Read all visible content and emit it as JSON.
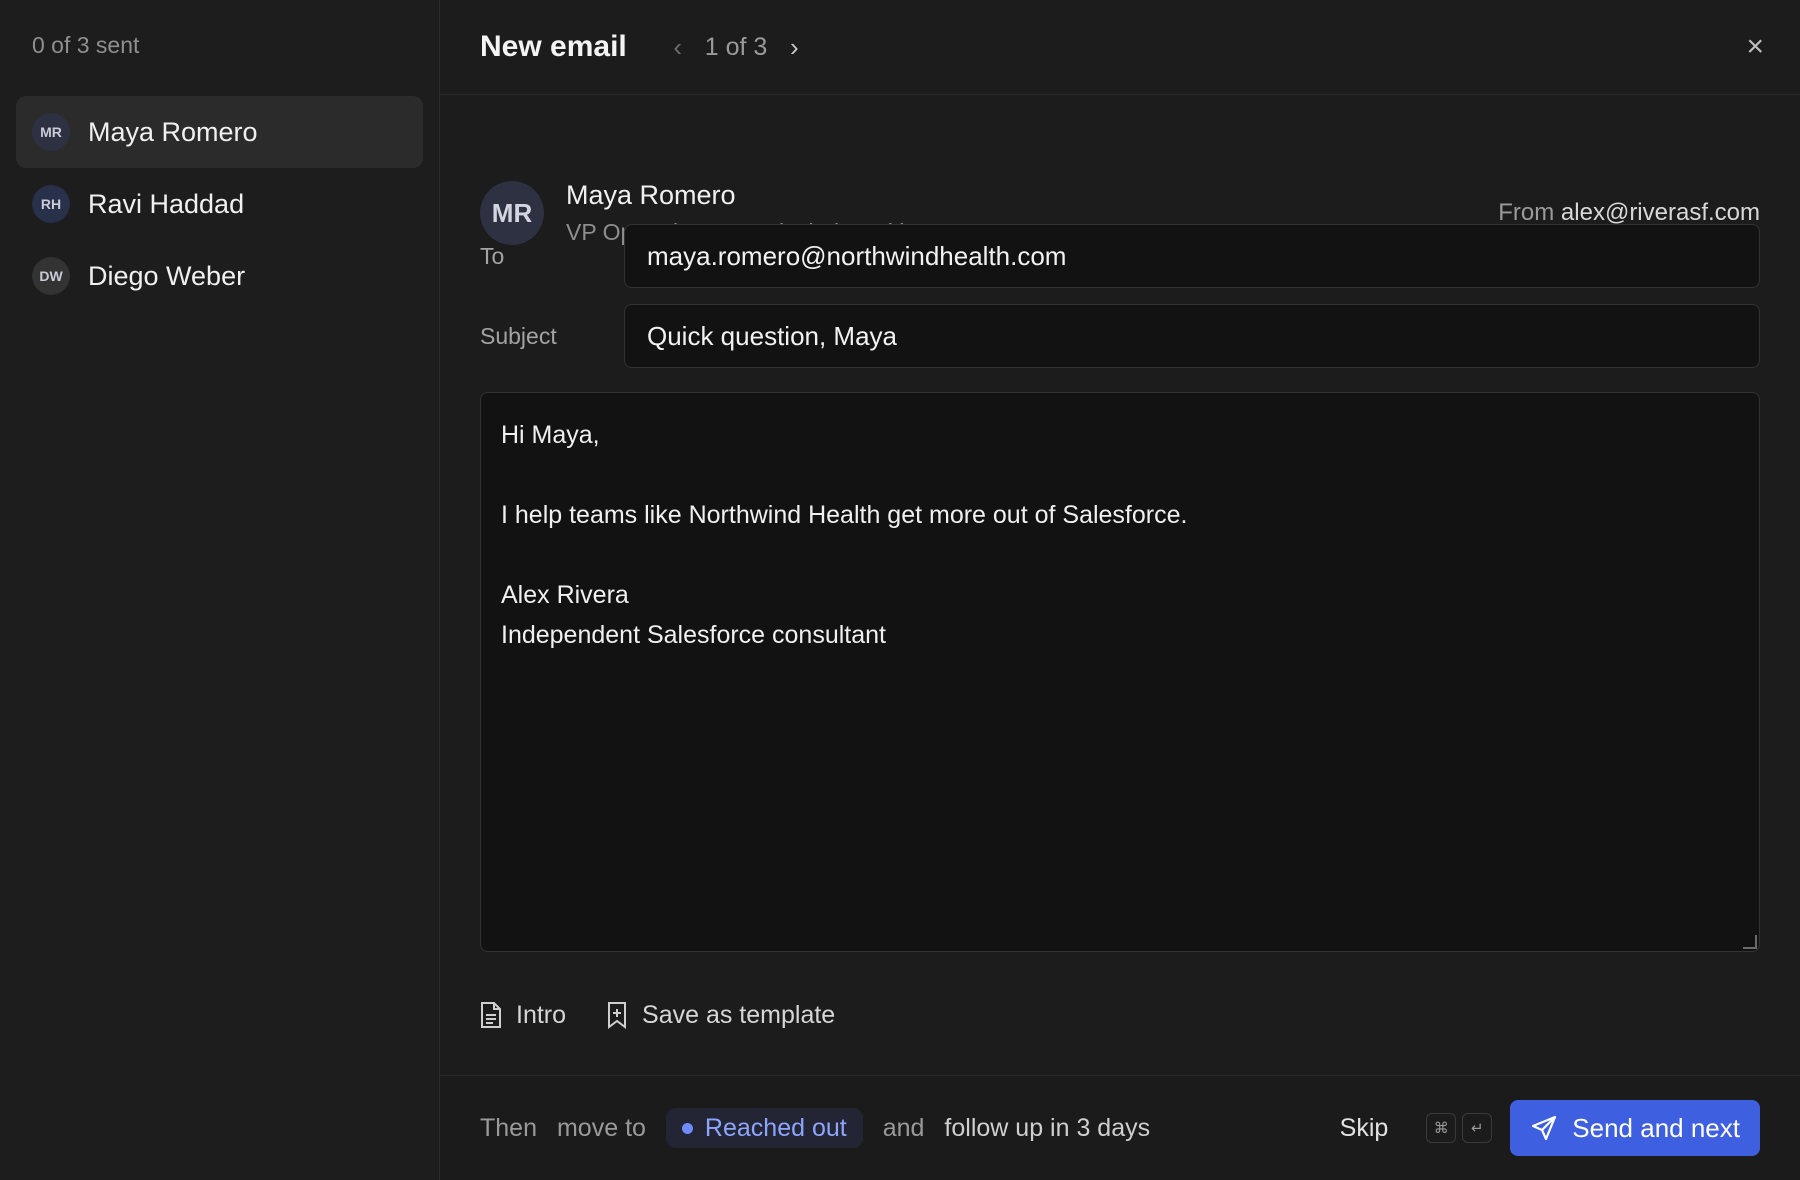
{
  "sidebar": {
    "sent_count": "0 of 3 sent",
    "recipients": [
      {
        "initials": "MR",
        "name": "Maya Romero"
      },
      {
        "initials": "RH",
        "name": "Ravi Haddad"
      },
      {
        "initials": "DW",
        "name": "Diego Weber"
      }
    ],
    "selected_index": 0
  },
  "header": {
    "title": "New email",
    "prev_icon": "chevron-left-icon",
    "pager": "1 of 3",
    "next_icon": "chevron-right-icon",
    "close_icon": "close-icon",
    "close_glyph": "×"
  },
  "contact": {
    "initials": "MR",
    "name": "Maya Romero",
    "title_company": "VP Operations · Northwind Health",
    "from_label": "From",
    "from_address": "alex@riverasf.com"
  },
  "form": {
    "to_label": "To",
    "to_value": "maya.romero@northwindhealth.com",
    "subject_label": "Subject",
    "subject_value": "Quick question, Maya",
    "body_lines": [
      "Hi Maya,",
      "",
      "I help teams like Northwind Health get more out of Salesforce.",
      "",
      "Alex Rivera",
      "Independent Salesforce consultant"
    ]
  },
  "tools": {
    "template_label": "Intro",
    "save_template_label": "Save as template"
  },
  "footer": {
    "then_label": "Then",
    "move_to_label": "move to",
    "stage_label": "Reached out",
    "and_label": "and",
    "follow_up_label": "follow up in 3 days",
    "skip_label": "Skip",
    "shortcut_cmd": "⌘",
    "shortcut_enter": "↵",
    "send_label": "Send and next"
  },
  "colors": {
    "accent": "#3e5fe0",
    "stage_dot": "#6f8bff",
    "background": "#1b1b1b"
  }
}
